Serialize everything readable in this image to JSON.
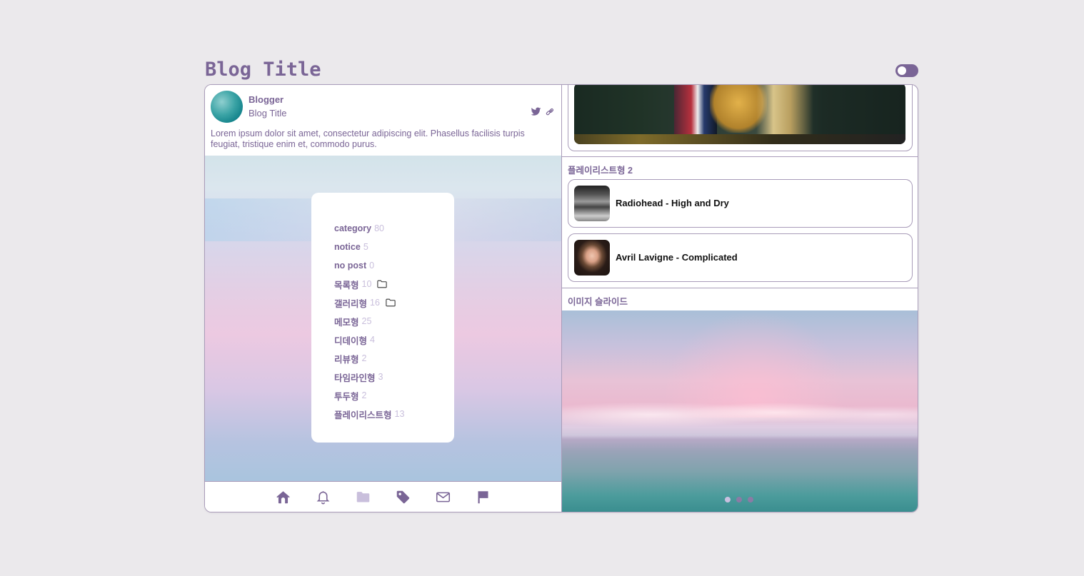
{
  "header": {
    "title": "Blog Title"
  },
  "profile": {
    "name": "Blogger",
    "subtitle": "Blog Title",
    "description": "Lorem ipsum dolor sit amet, consectetur adipiscing elit. Phasellus facilisis turpis feugiat, tristique enim et, commodo purus."
  },
  "categories": [
    {
      "label": "category",
      "count": "80",
      "folder": false
    },
    {
      "label": "notice",
      "count": "5",
      "folder": false
    },
    {
      "label": "no post",
      "count": "0",
      "folder": false
    },
    {
      "label": "목록형",
      "count": "10",
      "folder": true
    },
    {
      "label": "갤러리형",
      "count": "16",
      "folder": true
    },
    {
      "label": "메모형",
      "count": "25",
      "folder": false
    },
    {
      "label": "디데이형",
      "count": "4",
      "folder": false
    },
    {
      "label": "리뷰형",
      "count": "2",
      "folder": false
    },
    {
      "label": "타임라인형",
      "count": "3",
      "folder": false
    },
    {
      "label": "투두형",
      "count": "2",
      "folder": false
    },
    {
      "label": "플레이리스트형",
      "count": "13",
      "folder": false
    }
  ],
  "bottom_nav": [
    "home-icon",
    "bell-icon",
    "folder-icon",
    "tag-icon",
    "mail-icon",
    "flag-icon"
  ],
  "playlist2": {
    "title": "플레이리스트형 2",
    "tracks": [
      {
        "name": "Radiohead - High and Dry"
      },
      {
        "name": "Avril Lavigne - Complicated"
      }
    ]
  },
  "slider": {
    "title": "이미지 슬라이드",
    "dots": 3,
    "active": 0
  },
  "colors": {
    "accent": "#7a6596",
    "background": "#ebe9ec",
    "border": "#a99cb9",
    "muted": "#c9bfdc"
  }
}
